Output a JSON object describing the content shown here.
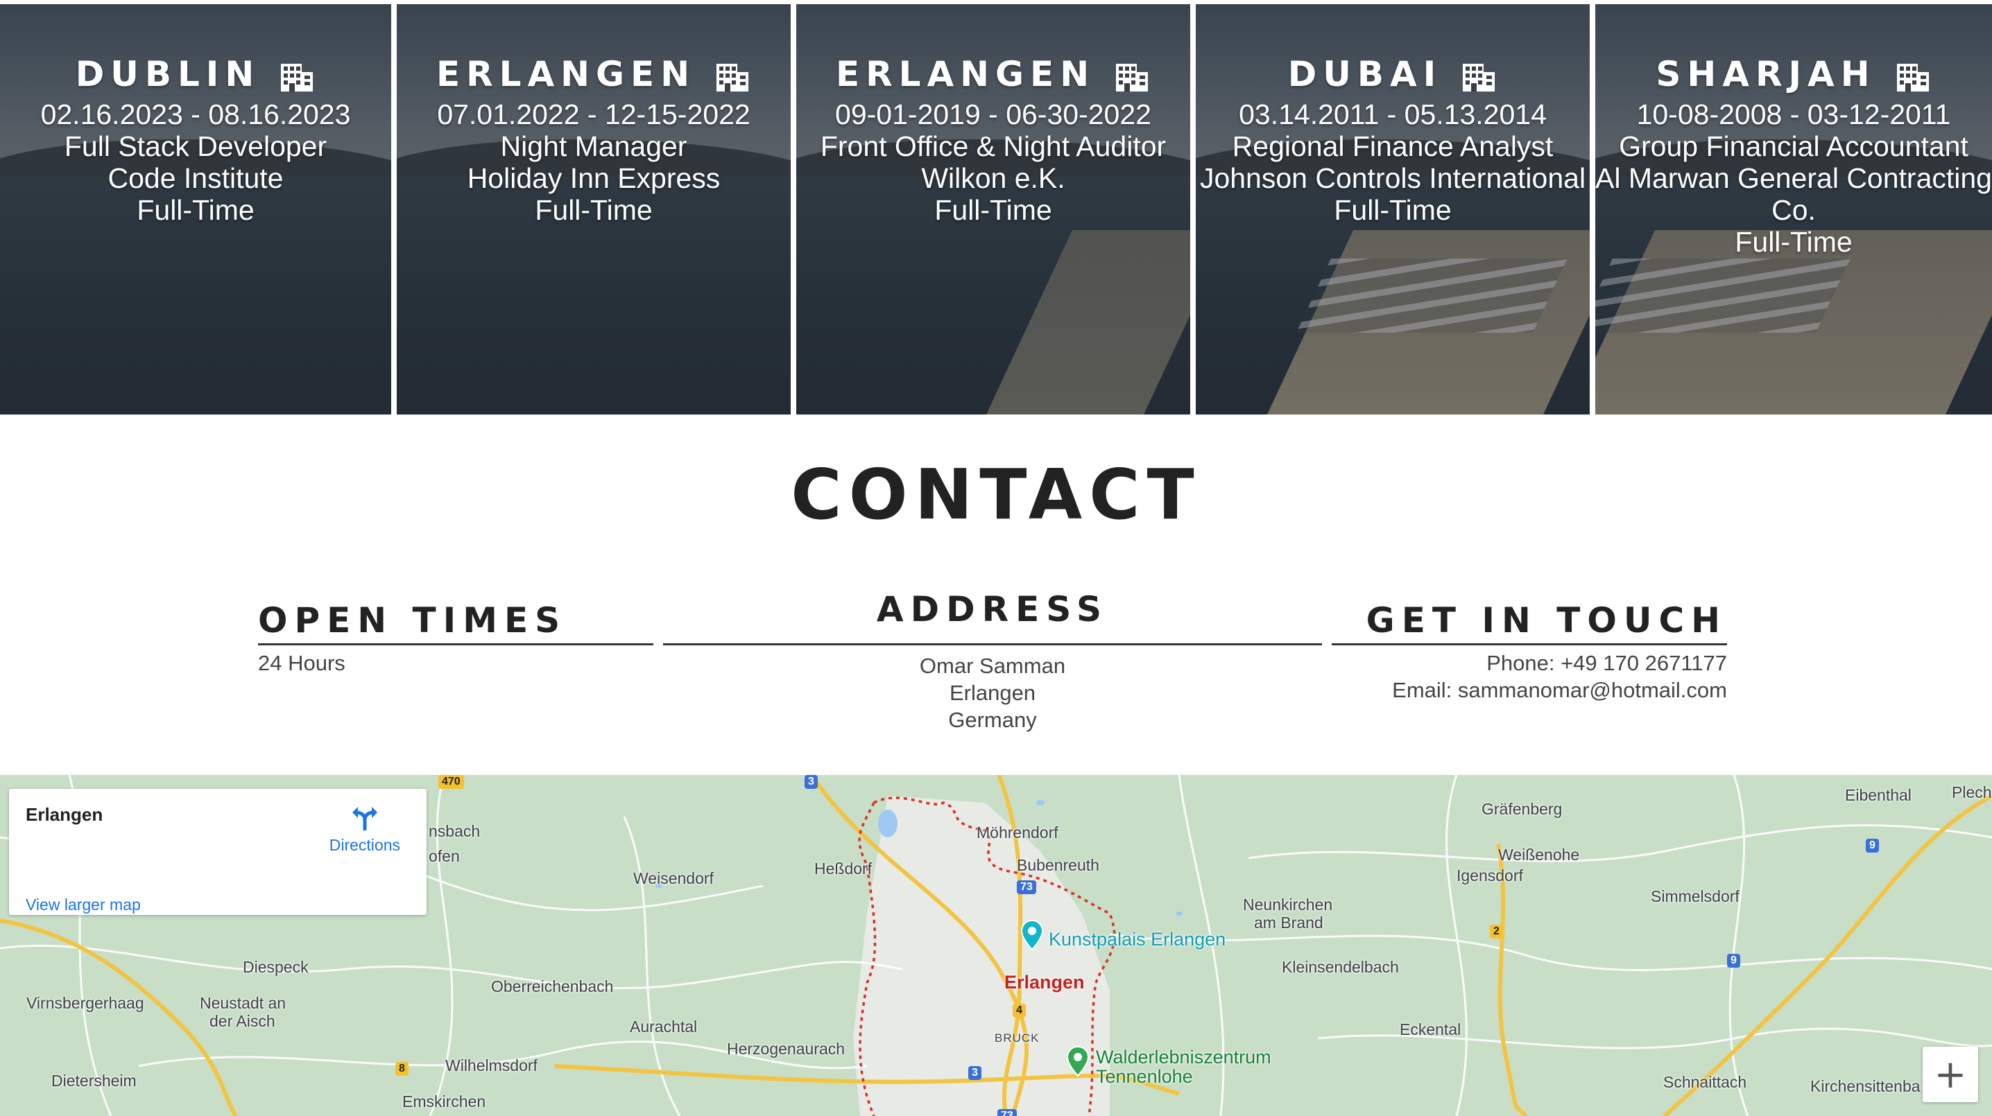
{
  "experience": [
    {
      "city": "DUBLIN",
      "dates": "02.16.2023 - 08.16.2023",
      "role": "Full Stack Developer",
      "company": "Code Institute",
      "type": "Full-Time"
    },
    {
      "city": "ERLANGEN",
      "dates": "07.01.2022 - 12-15-2022",
      "role": "Night Manager",
      "company": "Holiday Inn Express",
      "type": "Full-Time"
    },
    {
      "city": "ERLANGEN",
      "dates": "09-01-2019 - 06-30-2022",
      "role": "Front Office & Night Auditor",
      "company": "Wilkon e.K.",
      "type": "Full-Time"
    },
    {
      "city": "DUBAI",
      "dates": "03.14.2011 - 05.13.2014",
      "role": "Regional Finance Analyst",
      "company": "Johnson Controls International",
      "type": "Full-Time"
    },
    {
      "city": "SHARJAH",
      "dates": "10-08-2008 - 03-12-2011",
      "role": "Group Financial Accountant",
      "company": "Al Marwan General Contracting Co.",
      "type": "Full-Time"
    }
  ],
  "contact": {
    "title": "CONTACT",
    "open_times": {
      "heading": "OPEN TIMES",
      "value": "24 Hours"
    },
    "address": {
      "heading": "ADDRESS",
      "name": "Omar Samman",
      "city": "Erlangen",
      "country": "Germany"
    },
    "get_in_touch": {
      "heading": "GET IN TOUCH",
      "phone": "Phone: +49 170 2671177",
      "email": "Email: sammanomar@hotmail.com"
    }
  },
  "map": {
    "place_name": "Erlangen",
    "directions_label": "Directions",
    "view_larger_label": "View larger map",
    "zoom_in_label": "+",
    "labels": {
      "moehrendorf": "Möhrendorf",
      "bubenreuth": "Bubenreuth",
      "hessdorf": "Heßdorf",
      "weisendorf": "Weisendorf",
      "erlangen": "Erlangen",
      "kunstpalais": "Kunstpalais Erlangen",
      "walderlebnis1": "Walderlebniszentrum",
      "walderlebnis2": "Tennenlohe",
      "bruck": "BRUCK",
      "herzogenaurach": "Herzogenaurach",
      "aurachtal": "Aurachtal",
      "oberreichenbach": "Oberreichenbach",
      "diespeck": "Diespeck",
      "virnsbergerhaag": "Virnsbergerhaag",
      "neustadt1": "Neustadt an",
      "neustadt2": "der Aisch",
      "dietersheim": "Dietersheim",
      "wilhelmsdorf": "Wilhelmsdorf",
      "emskirchen": "Emskirchen",
      "nsbach": "nsbach",
      "ofen": "ofen",
      "graefenberg": "Gräfenberg",
      "weissenohe": "Weißenohe",
      "igensdorf": "Igensdorf",
      "neunkirchen1": "Neunkirchen",
      "neunkirchen2": "am Brand",
      "kleinsendelbach": "Kleinsendelbach",
      "eckental": "Eckental",
      "simmelsdorf": "Simmelsdorf",
      "schnaittach": "Schnaittach",
      "kirchensittenba": "Kirchensittenba",
      "eibenthal": "Eibenthal",
      "plech": "Plech"
    },
    "shields": {
      "a73a": "73",
      "a73b": "73",
      "b4": "4",
      "a3a": "3",
      "a3b": "3",
      "a9a": "9",
      "a9b": "9",
      "b2": "2",
      "b8": "8",
      "b470": "470"
    }
  }
}
